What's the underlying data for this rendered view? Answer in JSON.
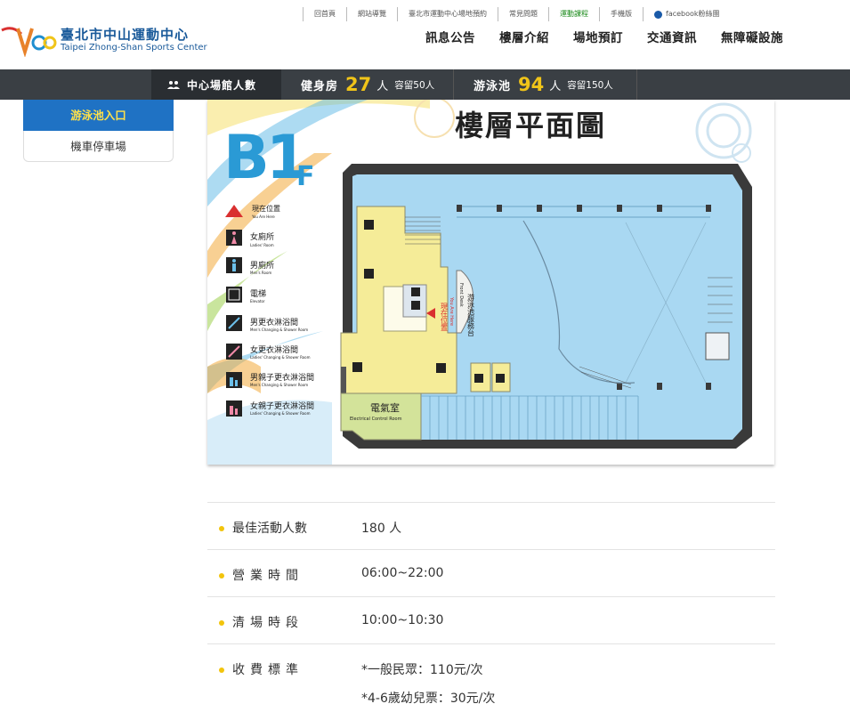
{
  "header": {
    "logo_title": "臺北市中山運動中心",
    "logo_subtitle": "Taipei Zhong-Shan Sports Center",
    "top_links": [
      "回首頁",
      "網站導覽",
      "臺北市運動中心場地預約",
      "常見問題",
      "運動課程",
      "手機版",
      "facebook粉絲團"
    ],
    "main_nav": [
      "訊息公告",
      "樓層介紹",
      "場地預訂",
      "交通資訊",
      "無障礙設施"
    ]
  },
  "stats": {
    "center_label": "中心場館人數",
    "gym": {
      "name": "健身房",
      "count": "27",
      "unit": "人",
      "capacity": "容留50人"
    },
    "pool": {
      "name": "游泳池",
      "count": "94",
      "unit": "人",
      "capacity": "容留150人"
    }
  },
  "sidebar": {
    "items": [
      {
        "label": "游泳池入口",
        "active": true
      },
      {
        "label": "機車停車場",
        "active": false
      }
    ]
  },
  "floor_map": {
    "floor_label": "B1",
    "floor_suffix": "F",
    "title": "樓層平面圖",
    "legend": [
      {
        "zh": "現在位置",
        "en": "You Are Here"
      },
      {
        "zh": "女廁所",
        "en": "Ladies' Room"
      },
      {
        "zh": "男廁所",
        "en": "Men's Room"
      },
      {
        "zh": "電梯",
        "en": "Elevator"
      },
      {
        "zh": "男更衣淋浴間",
        "en": "Men's Changing & Shower Room"
      },
      {
        "zh": "女更衣淋浴間",
        "en": "Ladies' Changing & Shower Room"
      },
      {
        "zh": "男親子更衣淋浴間",
        "en": "Men's Changing & Shower Room"
      },
      {
        "zh": "女親子更衣淋浴間",
        "en": "Ladies' Changing & Shower Room"
      }
    ],
    "electrical_room_zh": "電氣室",
    "electrical_room_en": "Electrical Control Room",
    "service_desk": "游泳池服務台",
    "front_desk_en": "Front Desk",
    "you_are_here_zh": "現在位置",
    "you_are_here_en": "You Are Here"
  },
  "info": [
    {
      "label": "最佳活動人數",
      "values": [
        "180 人"
      ]
    },
    {
      "label": "營業時間",
      "values": [
        "06:00~22:00"
      ]
    },
    {
      "label": "清場時段",
      "values": [
        "10:00~10:30"
      ]
    },
    {
      "label": "收費標準",
      "values": [
        "*一般民眾：110元/次",
        "*4-6歲幼兒票：30元/次"
      ]
    }
  ],
  "colors": {
    "brand_blue": "#1a5a9a",
    "accent_yellow": "#f0c419",
    "stats_bar": "#3a3f44",
    "active_side": "#1f72c4",
    "pool_blue": "#a9d8f2",
    "room_yellow": "#f5ec98",
    "room_green": "#d3e39a"
  }
}
